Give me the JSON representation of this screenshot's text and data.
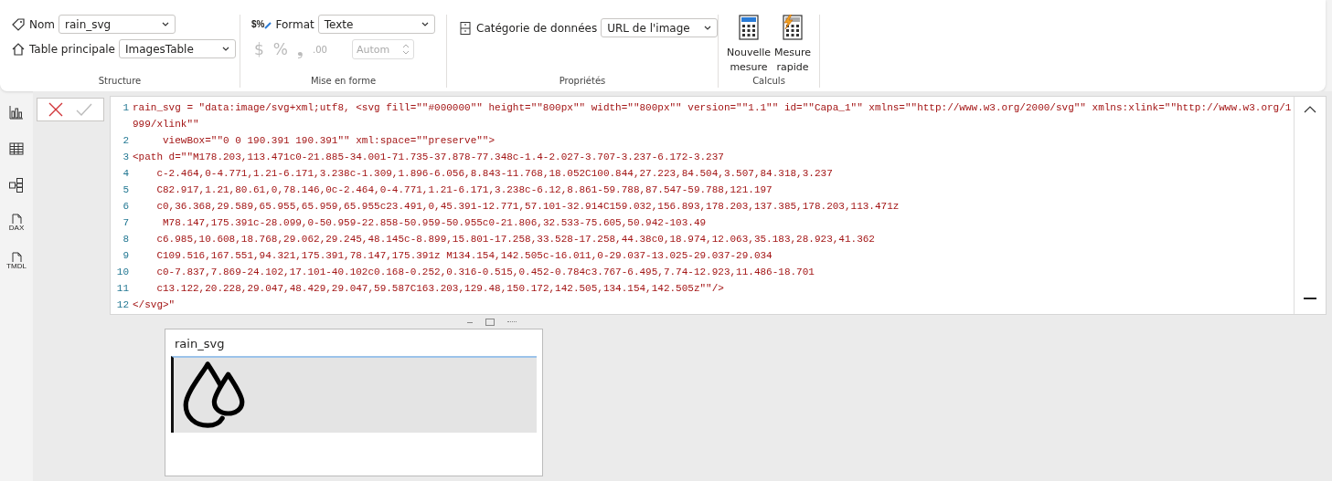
{
  "ribbon": {
    "groups": [
      {
        "kind": "structure",
        "label": "Structure",
        "name": {
          "label": "Nom",
          "value": "rain_svg"
        },
        "home_table": {
          "label": "Table principale",
          "value": "ImagesTable"
        }
      },
      {
        "kind": "formatting",
        "label": "Mise en forme",
        "format": {
          "icon_text": "$%",
          "label": "Format",
          "value": "Texte"
        },
        "buttons": [
          {
            "symbol": "$",
            "disabled": true
          },
          {
            "symbol": "%",
            "disabled": true
          },
          {
            "symbol": "❟",
            "disabled": true
          },
          {
            "symbol": ".00",
            "disabled": true
          }
        ],
        "decimals": {
          "value": "Autom",
          "disabled": true
        }
      },
      {
        "kind": "properties",
        "label": "Propriétés",
        "category": {
          "label": "Catégorie de données",
          "value": "URL de l'image"
        }
      },
      {
        "kind": "calculations",
        "label": "Calculs",
        "buttons": [
          {
            "kind": "new",
            "label": "Nouvelle mesure"
          },
          {
            "kind": "quick",
            "label": "Mesure rapide"
          }
        ]
      }
    ]
  },
  "sidebar": {
    "items": [
      {
        "kind": "report"
      },
      {
        "kind": "table"
      },
      {
        "kind": "model"
      },
      {
        "kind": "dax",
        "label": "DAX"
      },
      {
        "kind": "tmdl",
        "label": "TMDL"
      }
    ]
  },
  "formula_bar": {
    "commit_disabled": true,
    "lines": [
      {
        "number": "1",
        "text": "rain_svg = \"data:image/svg+xml;utf8, <svg fill=\"\"#000000\"\" height=\"\"800px\"\" width=\"\"800px\"\" version=\"\"1.1\"\" id=\"\"Capa_1\"\" xmlns=\"\"http://www.w3.org/2000/svg\"\" xmlns:xlink=\"\"http://www.w3.org/1999/xlink\"\""
      },
      {
        "number": "2",
        "text": "     viewBox=\"\"0 0 190.391 190.391\"\" xml:space=\"\"preserve\"\">"
      },
      {
        "number": "3",
        "text": "<path d=\"\"M178.203,113.471c0-21.885-34.001-71.735-37.878-77.348c-1.4-2.027-3.707-3.237-6.172-3.237"
      },
      {
        "number": "4",
        "text": "    c-2.464,0-4.771,1.21-6.171,3.238c-1.309,1.896-6.056,8.843-11.768,18.052C100.844,27.223,84.504,3.507,84.318,3.237"
      },
      {
        "number": "5",
        "text": "    C82.917,1.21,80.61,0,78.146,0c-2.464,0-4.771,1.21-6.171,3.238c-6.12,8.861-59.788,87.547-59.788,121.197"
      },
      {
        "number": "6",
        "text": "    c0,36.368,29.589,65.955,65.959,65.955c23.491,0,45.391-12.771,57.101-32.914C159.032,156.893,178.203,137.385,178.203,113.471z"
      },
      {
        "number": "7",
        "text": "     M78.147,175.391c-28.099,0-50.959-22.858-50.959-50.955c0-21.806,32.533-75.605,50.942-103.49"
      },
      {
        "number": "8",
        "text": "    c6.985,10.608,18.768,29.062,29.245,48.145c-8.899,15.801-17.258,33.528-17.258,44.38c0,18.974,12.063,35.183,28.923,41.362"
      },
      {
        "number": "9",
        "text": "    C109.516,167.551,94.321,175.391,78.147,175.391z M134.154,142.505c-16.011,0-29.037-13.025-29.037-29.034"
      },
      {
        "number": "10",
        "text": "    c0-7.837,7.869-24.102,17.101-40.102c0.168-0.252,0.316-0.515,0.452-0.784c3.767-6.495,7.74-12.923,11.486-18.701"
      },
      {
        "number": "11",
        "text": "    c13.122,20.228,29.047,48.429,29.047,59.587C163.203,129.48,150.172,142.505,134.154,142.505z\"\"/>"
      },
      {
        "number": "12",
        "text": "</svg>\""
      }
    ]
  },
  "visual": {
    "title": "rain_svg"
  }
}
